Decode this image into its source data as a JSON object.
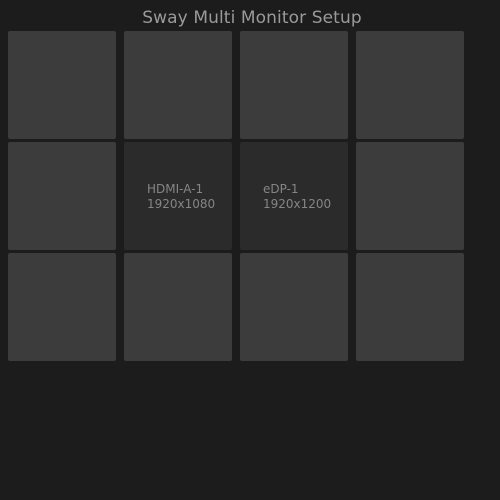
{
  "window": {
    "title": "Sway Multi Monitor Setup"
  },
  "colors": {
    "background": "#1c1c1c",
    "empty_slot": "#3c3c3c",
    "monitor_slot": "#2b2b2b",
    "text": "#9a9a9a"
  },
  "grid": {
    "columns": 4,
    "rows": 3
  },
  "monitors": [
    {
      "slot": "row2-col2",
      "name": "HDMI-A-1",
      "resolution": "1920x1080"
    },
    {
      "slot": "row2-col3",
      "name": "eDP-1",
      "resolution": "1920x1200"
    }
  ]
}
